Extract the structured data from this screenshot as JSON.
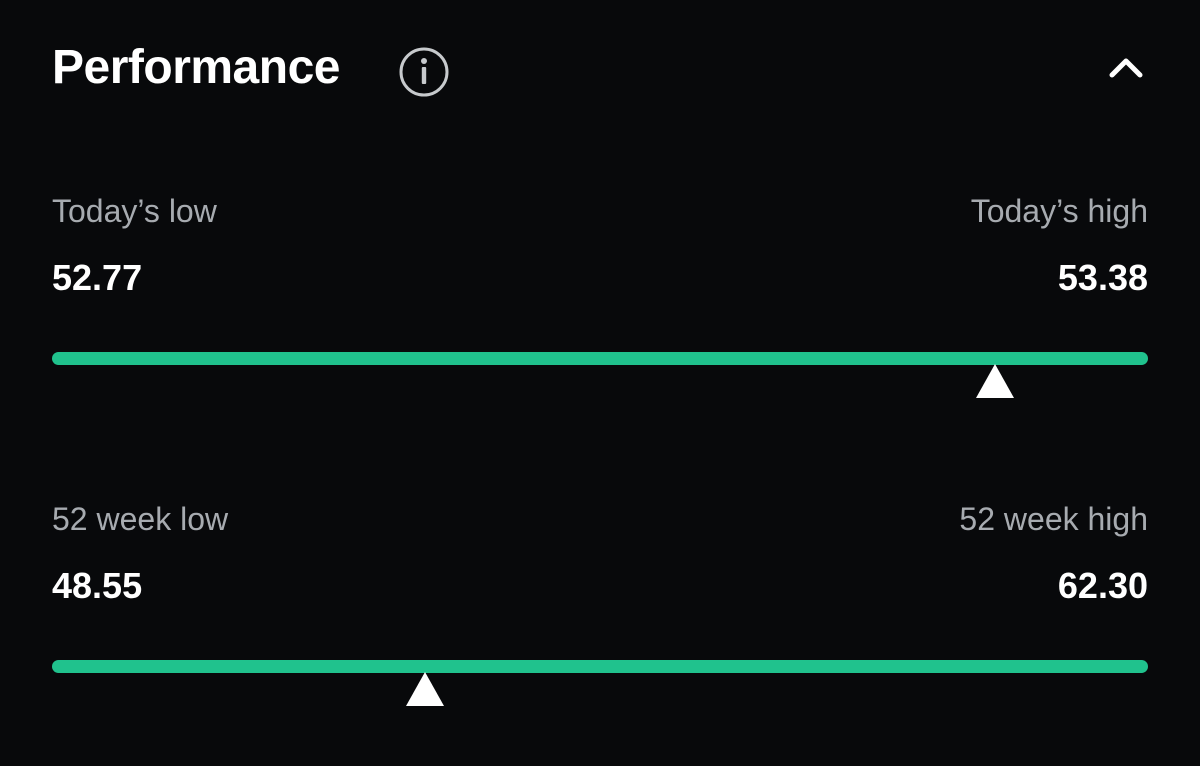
{
  "header": {
    "title": "Performance",
    "info_icon": "info-circle-icon",
    "collapse_icon": "chevron-up-icon"
  },
  "colors": {
    "background": "#08090b",
    "track": "#20c28d",
    "marker": "#ffffff",
    "label": "#a7abb0"
  },
  "ranges": [
    {
      "low_label": "Today’s low",
      "high_label": "Today’s high",
      "low_value": "52.77",
      "high_value": "53.38",
      "position_fraction": 0.86
    },
    {
      "low_label": "52 week low",
      "high_label": "52 week high",
      "low_value": "48.55",
      "high_value": "62.30",
      "position_fraction": 0.34
    }
  ]
}
